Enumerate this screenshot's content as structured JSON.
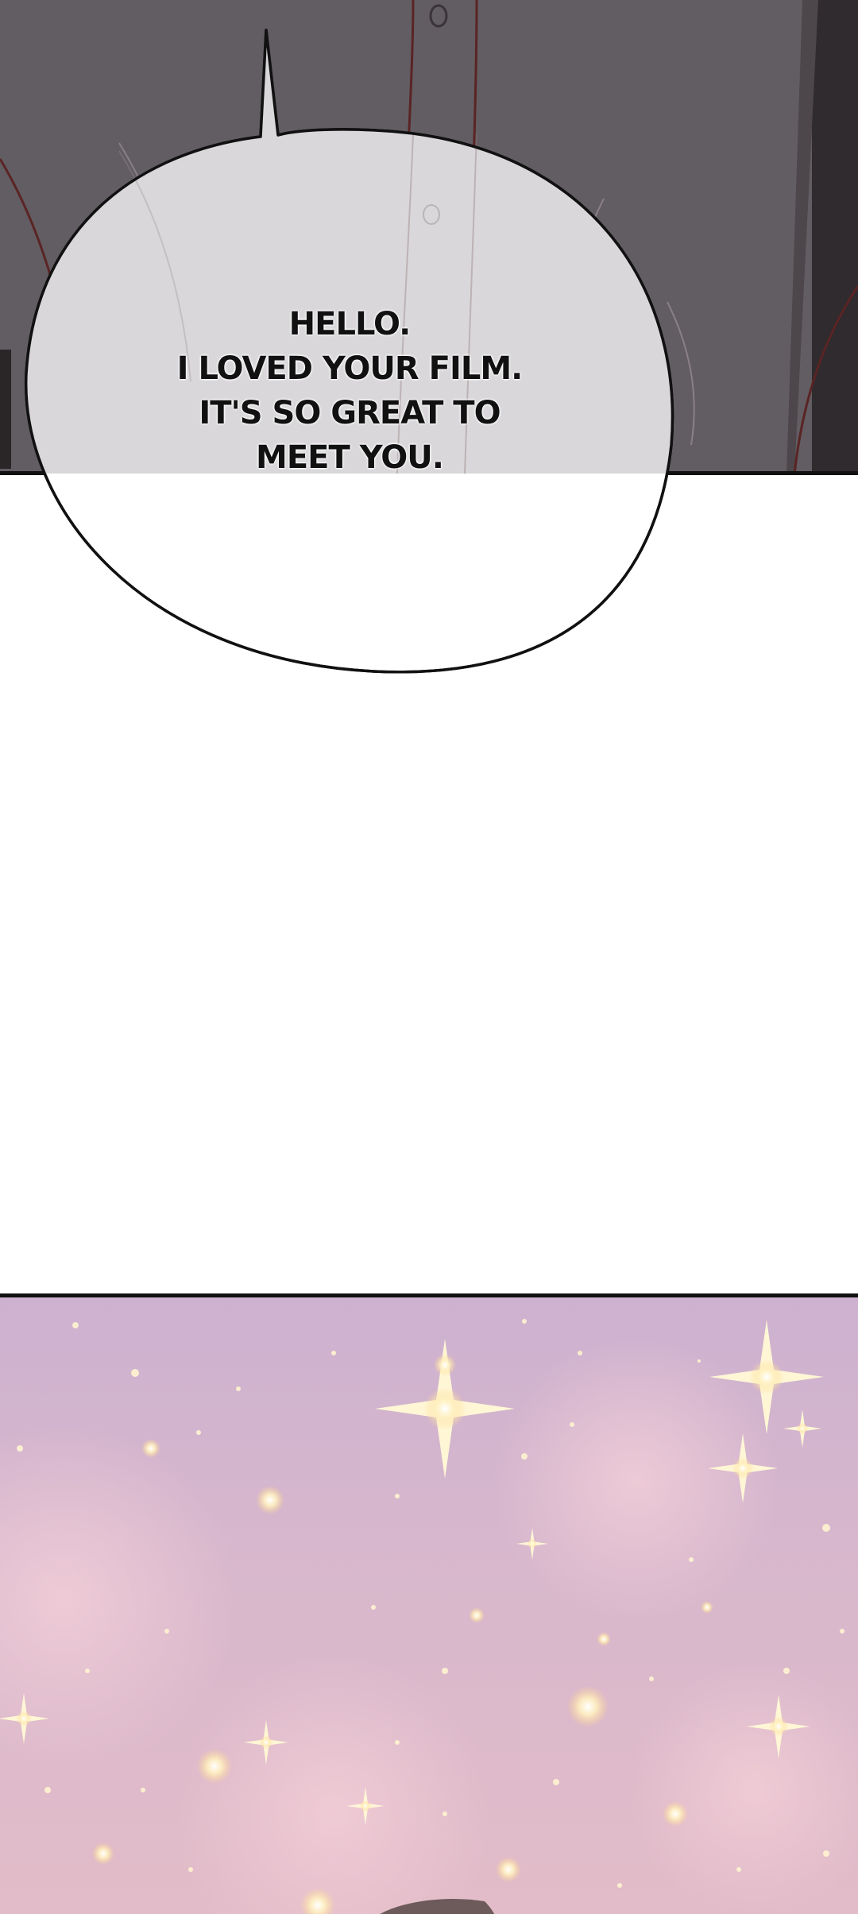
{
  "speech_bubble": {
    "lines": [
      "HELLO.",
      "I LOVED YOUR FILM.",
      "IT'S SO GREAT TO",
      "MEET YOU."
    ]
  },
  "colors": {
    "shirt": "#625d63",
    "bubble_fill": "#d4d2d5",
    "sparkle_bg": "#d7b7cd",
    "sparkle": "#fff3c8"
  },
  "icons": {
    "top_panel": "shirt-illustration",
    "bottom_panel": "sparkle-bokeh-illustration"
  }
}
